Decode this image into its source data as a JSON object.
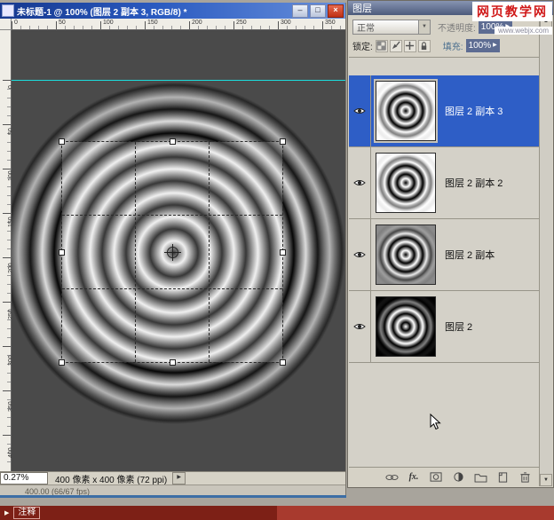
{
  "window": {
    "title": "未标题-1 @ 100% (图层 2 副本 3, RGB/8) *",
    "minimize": "–",
    "maximize": "□",
    "close": "×"
  },
  "ruler": {
    "top_labels": [
      "0",
      "50",
      "100",
      "150",
      "200",
      "250",
      "300",
      "350"
    ],
    "left_labels": [
      "0",
      "50",
      "100",
      "150",
      "200",
      "250",
      "300",
      "350",
      "400"
    ]
  },
  "status": {
    "zoom": "0.27%",
    "doc_info": "400 像素 x 400 像素 (72 ppi)",
    "menu_arrow": "▶",
    "partial": "400.00  (66/67 fps)"
  },
  "annotation": {
    "arrow": "▶",
    "label": "注释"
  },
  "layers_panel": {
    "title": "图层",
    "close": "×",
    "blend_mode": "正常",
    "blend_arrow": "▼",
    "opacity_label": "不透明度:",
    "opacity_value": "100%",
    "opacity_arrow": "▶",
    "lock_label": "锁定:",
    "fill_label": "填充:",
    "fill_value": "100%",
    "fill_arrow": "▶",
    "layers": [
      {
        "name": "图层 2 副本 3",
        "selected": true
      },
      {
        "name": "图层 2 副本 2",
        "selected": false
      },
      {
        "name": "图层 2 副本",
        "selected": false
      },
      {
        "name": "图层 2",
        "selected": false
      }
    ],
    "toolbar_fx": "fx.",
    "scroll_up": "▲",
    "scroll_down": "▼"
  },
  "watermark": {
    "title": "网页教学网",
    "url": "www.webjx.com"
  },
  "colors": {
    "selected_layer": "#2e5ec6",
    "guide": "#1bdede",
    "titlebar": "#2a5ac0",
    "annotation_dark": "#7d2016",
    "annotation_light": "#a83a2e",
    "canvas_bg": "#4a4a4a"
  }
}
